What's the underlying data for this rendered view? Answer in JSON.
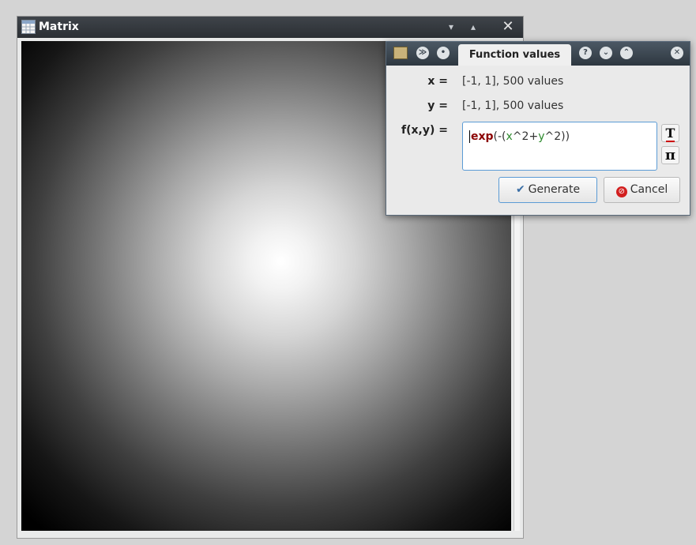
{
  "matrix_window": {
    "title": "Matrix",
    "buttons": {
      "minimize": "▾",
      "maximize": "▴",
      "close": "✕"
    }
  },
  "dialog": {
    "tab_label": "Function values",
    "x_label": "x =",
    "x_value": "[-1, 1], 500 values",
    "y_label": "y =",
    "y_value": "[-1, 1], 500 values",
    "f_label": "f(x,y) =",
    "formula": {
      "fn": "exp",
      "open": "(-(",
      "x": "x",
      "mid": "^2+",
      "y": "y",
      "close": "^2))"
    },
    "side_buttons": {
      "text_format": "T",
      "constants": "π"
    },
    "generate_label": "Generate",
    "cancel_label": "Cancel",
    "titlebar_icons": [
      "app-icon",
      "collapse-icon",
      "pin-icon",
      "help-icon",
      "minimize-icon",
      "maximize-icon",
      "close-icon"
    ]
  }
}
